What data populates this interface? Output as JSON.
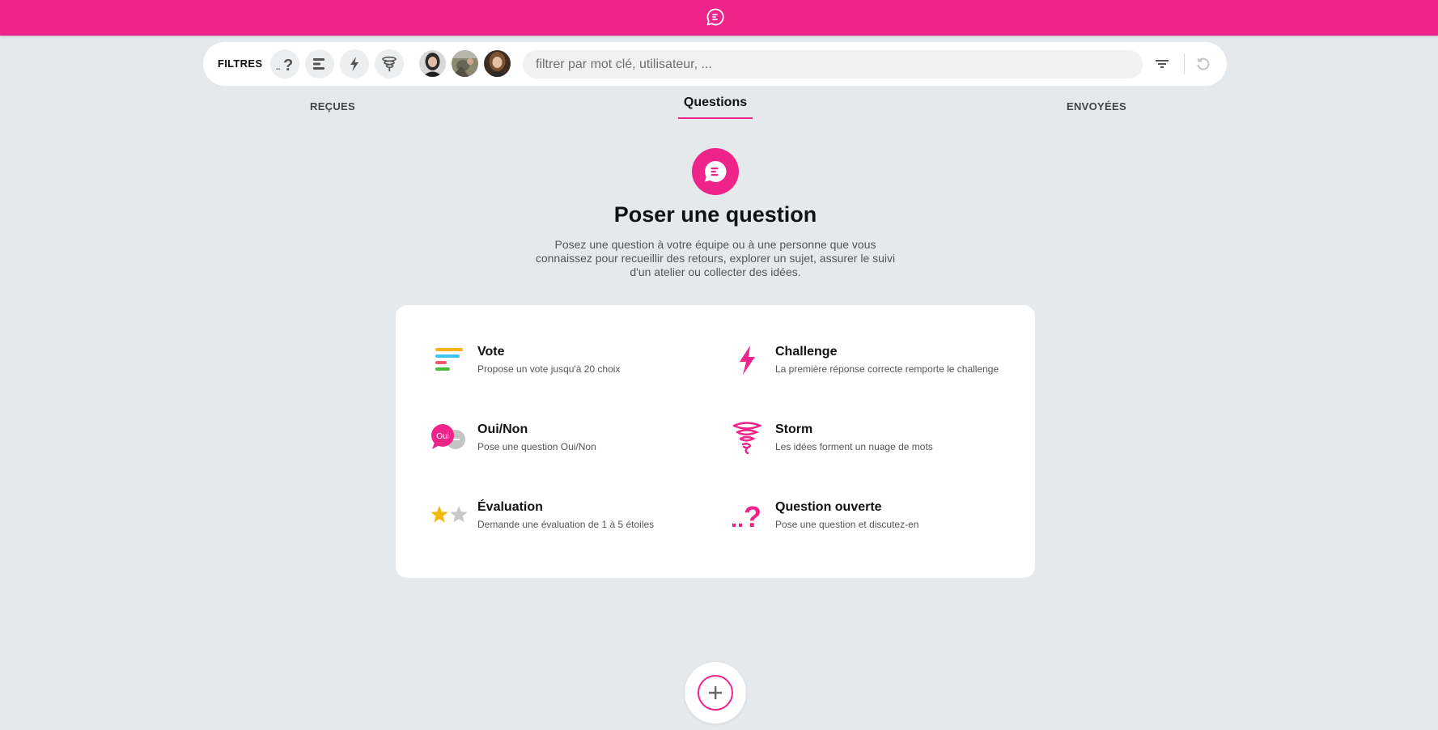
{
  "brand": {
    "color": "#ee248b",
    "logo_icon": "chat-bubble-logo-icon"
  },
  "filter_bar": {
    "label": "FILTRES",
    "type_filters": [
      {
        "name": "question-ouverte",
        "icon": "question-icon"
      },
      {
        "name": "vote",
        "icon": "poll-bars-icon"
      },
      {
        "name": "challenge",
        "icon": "lightning-icon"
      },
      {
        "name": "storm",
        "icon": "tornado-icon"
      }
    ],
    "avatars": [
      "user-avatar-1",
      "user-avatar-2",
      "user-avatar-3"
    ],
    "search_placeholder": "filtrer par mot clé, utilisateur, ...",
    "actions": [
      "filter-lines-icon",
      "refresh-icon"
    ]
  },
  "tabs": {
    "received": "REÇUES",
    "questions": "Questions",
    "sent": "ENVOYÉES",
    "active": "questions"
  },
  "hero": {
    "title": "Poser une question",
    "description": "Posez une question à votre équipe ou à une personne que vous connaissez pour recueillir des retours, explorer un sujet, assurer le suivi d'un atelier ou collecter des idées."
  },
  "options": [
    {
      "title": "Vote",
      "description": "Propose un vote jusqu'à 20 choix",
      "icon": "vote-bars-icon"
    },
    {
      "title": "Challenge",
      "description": "La première réponse correcte remporte le challenge",
      "icon": "lightning-icon"
    },
    {
      "title": "Oui/Non",
      "description": "Pose une question Oui/Non",
      "icon": "yes-no-bubbles-icon",
      "badge": "Oui"
    },
    {
      "title": "Storm",
      "description": "Les idées forment un nuage de mots",
      "icon": "tornado-icon"
    },
    {
      "title": "Évaluation",
      "description": "Demande une évaluation de 1 à 5 étoiles",
      "icon": "stars-rating-icon"
    },
    {
      "title": "Question ouverte",
      "description": "Pose une question et discutez-en",
      "icon": "open-question-icon"
    }
  ],
  "fab": {
    "icon": "plus-icon"
  }
}
